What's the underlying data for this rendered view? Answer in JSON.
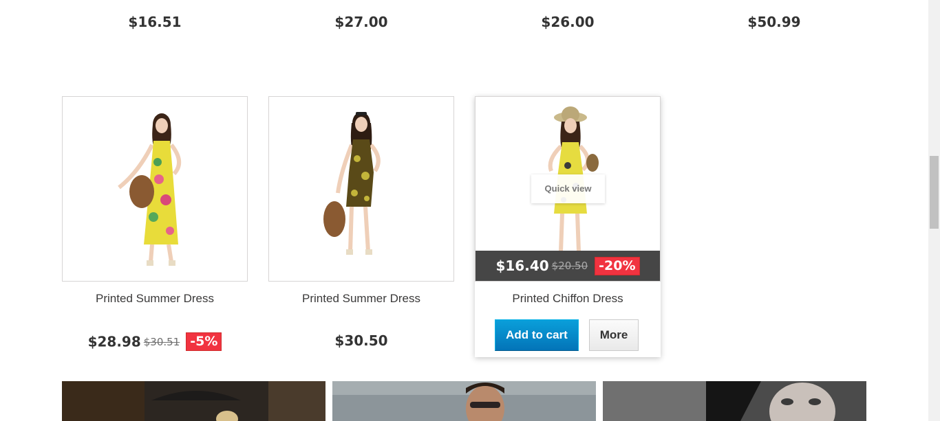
{
  "top_prices": [
    "$16.51",
    "$27.00",
    "$26.00",
    "$50.99"
  ],
  "products": [
    {
      "name": "Printed Summer Dress",
      "price": "$28.98",
      "old_price": "$30.51",
      "discount": "-5%",
      "dress_color": "#e8dc3a"
    },
    {
      "name": "Printed Summer Dress",
      "price": "$30.50",
      "dress_color": "#5a4a18"
    },
    {
      "name": "Printed Chiffon Dress",
      "price": "$16.40",
      "old_price": "$20.50",
      "discount": "-20%",
      "quick_view": "Quick view",
      "add_to_cart": "Add to cart",
      "more": "More",
      "dress_color": "#e6dc40"
    }
  ],
  "colors": {
    "accent_blue": "#0a8fd0",
    "discount_red": "#f13340"
  }
}
